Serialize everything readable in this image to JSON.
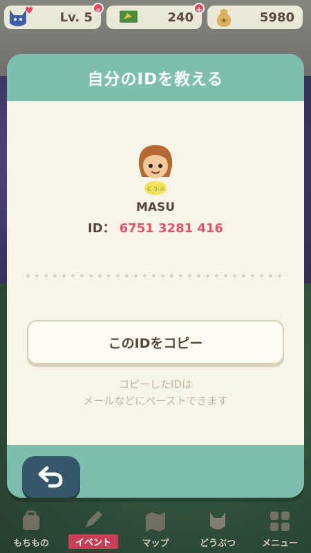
{
  "status_bar": {
    "level": "Lv. 5",
    "tickets": "240",
    "bells": "5980",
    "plus_badge": "+",
    "level_icon": "cat-face-icon",
    "ticket_icon": "ticket-icon",
    "bells_icon": "bell-bag-icon"
  },
  "modal": {
    "title": "自分のIDを教える",
    "user_name": "MASU",
    "id_label": "ID：",
    "id_value": "6751 3281 416",
    "copy_button": "このIDをコピー",
    "hint_line1": "コピーしたIDは",
    "hint_line2": "メールなどにペーストできます"
  },
  "bottom_nav": [
    {
      "label": "もちもの",
      "icon": "bag-icon"
    },
    {
      "label": "イベント",
      "icon": "pencil-icon"
    },
    {
      "label": "マップ",
      "icon": "map-icon"
    },
    {
      "label": "どうぶつ",
      "icon": "animal-icon"
    },
    {
      "label": "メニュー",
      "icon": "menu-grid-icon"
    }
  ],
  "colors": {
    "header_teal": "#7cbfae",
    "id_pink": "#e2536a",
    "back_button": "#35576a",
    "event_red": "#c83e56"
  }
}
